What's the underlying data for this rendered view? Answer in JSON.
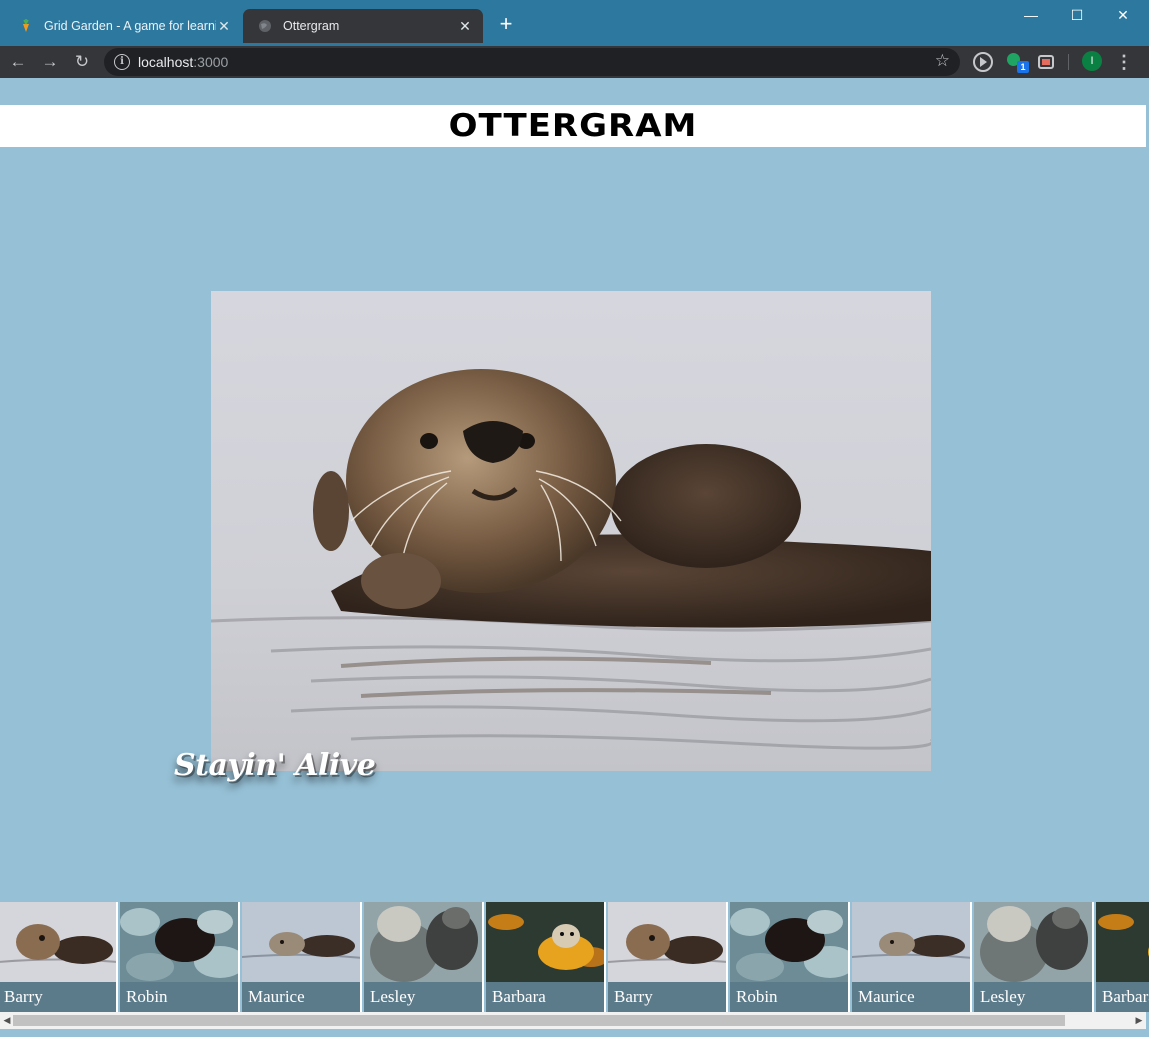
{
  "browser": {
    "tabs": [
      {
        "title": "Grid Garden - A game for learning CSS grid",
        "active": false
      },
      {
        "title": "Ottergram",
        "active": true
      }
    ],
    "address": {
      "host": "localhost",
      "port": ":3000"
    },
    "profile_initial": "I",
    "extension_badge": "1"
  },
  "page": {
    "logo": "OTTERGRAM",
    "detail": {
      "title": "Stayin' Alive",
      "image": "otter-floating-icon"
    },
    "thumbnails": [
      {
        "label": "Barry",
        "image": "barry"
      },
      {
        "label": "Robin",
        "image": "robin"
      },
      {
        "label": "Maurice",
        "image": "maurice"
      },
      {
        "label": "Lesley",
        "image": "lesley"
      },
      {
        "label": "Barbara",
        "image": "barbara"
      },
      {
        "label": "Barry",
        "image": "barry"
      },
      {
        "label": "Robin",
        "image": "robin"
      },
      {
        "label": "Maurice",
        "image": "maurice"
      },
      {
        "label": "Lesley",
        "image": "lesley"
      },
      {
        "label": "Barbara",
        "image": "barbara"
      }
    ]
  },
  "colors": {
    "page_bg": "#96c0d6",
    "label_bg": "#5c7b8a",
    "tabstrip": "#2d789e"
  }
}
